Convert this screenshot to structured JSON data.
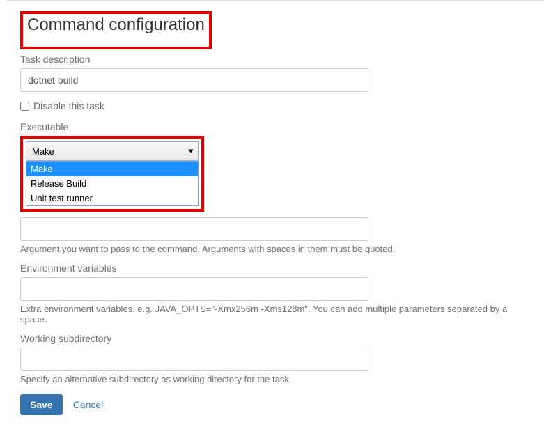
{
  "title": "Command configuration",
  "taskDescription": {
    "label": "Task description",
    "value": "dotnet build"
  },
  "disableTask": {
    "label": "Disable this task",
    "checked": false
  },
  "executable": {
    "label": "Executable",
    "selected": "Make",
    "options": [
      "Make",
      "Release Build",
      "Unit test runner"
    ]
  },
  "argument": {
    "help": "Argument you want to pass to the command. Arguments with spaces in them must be quoted."
  },
  "envVars": {
    "label": "Environment variables",
    "help": "Extra environment variables. e.g. JAVA_OPTS=\"-Xmx256m -Xms128m\". You can add multiple parameters separated by a space."
  },
  "workingSubdir": {
    "label": "Working subdirectory",
    "help": "Specify an alternative subdirectory as working directory for the task."
  },
  "buttons": {
    "save": "Save",
    "cancel": "Cancel"
  }
}
